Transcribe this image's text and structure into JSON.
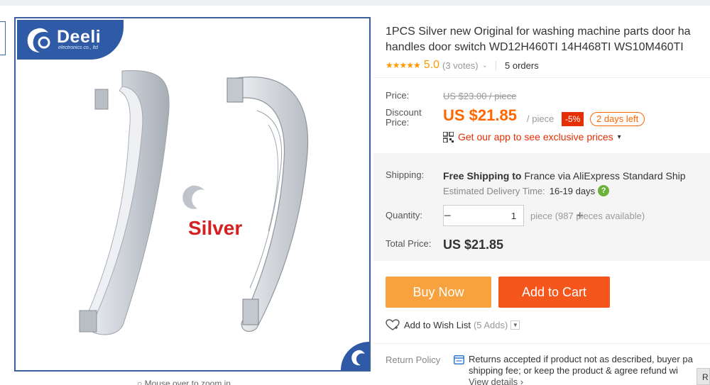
{
  "product": {
    "title_line1": "1PCS Silver new Original for washing machine parts door ha",
    "title_line2": "handles door switch WD12H460TI 14H468TI WS10M460TI"
  },
  "image": {
    "brand_name": "Deeli",
    "brand_sub": "electronics co., ltd",
    "overlay_text": "Silver",
    "zoom_hint": "Mouse over to zoom in"
  },
  "rating": {
    "stars": "★★★★★",
    "value": "5.0",
    "votes": "(3 votes)",
    "orders": "5 orders"
  },
  "price": {
    "label": "Price:",
    "original": "US $23.00 / piece",
    "discount_label_1": "Discount",
    "discount_label_2": "Price:",
    "current": "US $21.85",
    "per_unit": "/ piece",
    "discount_badge": "-5%",
    "time_left": "2 days left",
    "app_promo": "Get our app to see exclusive prices"
  },
  "shipping": {
    "label": "Shipping:",
    "free_bold": "Free Shipping to",
    "destination": "France via AliExpress Standard Ship",
    "est_label": "Estimated Delivery Time:",
    "est_days": "16-19 days",
    "help_icon": "?"
  },
  "quantity": {
    "label": "Quantity:",
    "minus": "−",
    "value": "1",
    "plus": "+",
    "available": "piece (987 pieces available)"
  },
  "total": {
    "label": "Total Price:",
    "value": "US $21.85"
  },
  "actions": {
    "buy_now": "Buy Now",
    "add_to_cart": "Add to Cart",
    "wish_label": "Add to Wish List",
    "wish_count": "(5 Adds)"
  },
  "returns": {
    "label": "Return Policy",
    "line1": "Returns accepted if product not as described, buyer pa",
    "line2": "shipping fee; or keep the product & agree refund wi",
    "view_details": "View details ›"
  },
  "side_chip": "R",
  "colors": {
    "accent_orange": "#f60",
    "buy_now": "#f7a23e",
    "add_to_cart": "#f5561c",
    "badge_red": "#e62e04",
    "star": "#f90",
    "brand_blue": "#2f5aa6"
  }
}
